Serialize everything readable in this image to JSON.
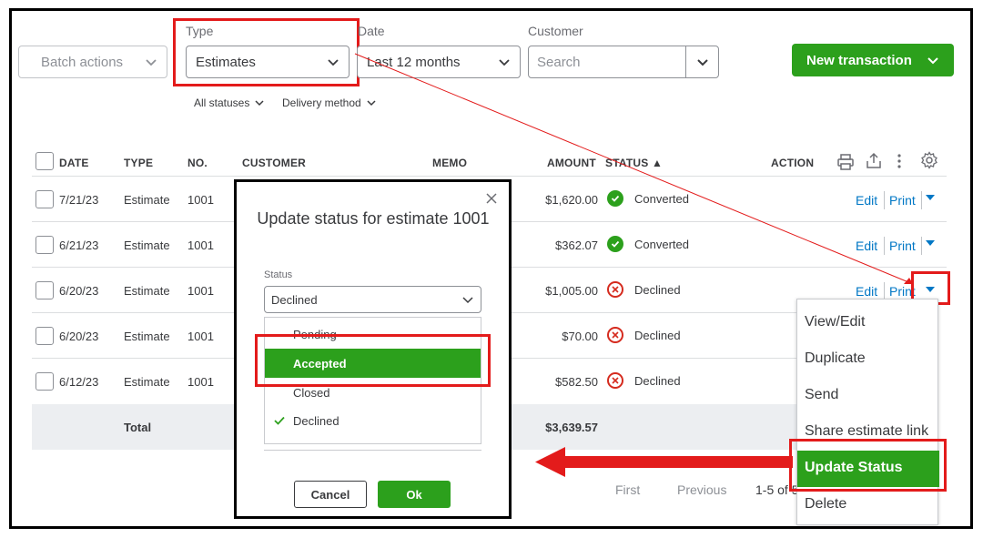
{
  "filters": {
    "batch_actions": "Batch actions",
    "type_label": "Type",
    "type_value": "Estimates",
    "date_label": "Date",
    "date_value": "Last 12 months",
    "customer_label": "Customer",
    "customer_placeholder": "Search",
    "new_transaction": "New transaction",
    "all_statuses": "All statuses",
    "delivery_method": "Delivery method"
  },
  "table": {
    "headers": {
      "date": "DATE",
      "type": "TYPE",
      "no": "NO.",
      "customer": "CUSTOMER",
      "memo": "MEMO",
      "amount": "AMOUNT",
      "status": "STATUS ▲",
      "action": "ACTION"
    },
    "rows": [
      {
        "date": "7/21/23",
        "type": "Estimate",
        "no": "1001",
        "amount": "$1,620.00",
        "status": "Converted",
        "edit": "Edit",
        "print": "Print"
      },
      {
        "date": "6/21/23",
        "type": "Estimate",
        "no": "1001",
        "amount": "$362.07",
        "status": "Converted",
        "edit": "Edit",
        "print": "Print"
      },
      {
        "date": "6/20/23",
        "type": "Estimate",
        "no": "1001",
        "amount": "$1,005.00",
        "status": "Declined",
        "edit": "Edit",
        "print": "Print"
      },
      {
        "date": "6/20/23",
        "type": "Estimate",
        "no": "1001",
        "amount": "$70.00",
        "status": "Declined"
      },
      {
        "date": "6/12/23",
        "type": "Estimate",
        "no": "1001",
        "amount": "$582.50",
        "status": "Declined"
      }
    ],
    "total_label": "Total",
    "total_amount": "$3,639.57"
  },
  "pagination": {
    "first": "First",
    "previous": "Previous",
    "range": "1-5 of 5"
  },
  "modal": {
    "title": "Update status for estimate 1001",
    "status_label": "Status",
    "status_value": "Declined",
    "options": [
      "Pending",
      "Accepted",
      "Closed",
      "Declined"
    ],
    "cancel": "Cancel",
    "ok": "Ok"
  },
  "action_menu": {
    "items": [
      "View/Edit",
      "Duplicate",
      "Send",
      "Share estimate link",
      "Update Status",
      "Delete"
    ]
  },
  "colors": {
    "green": "#2ca01c",
    "link": "#0077c5",
    "annotation_red": "#e31b1b"
  }
}
